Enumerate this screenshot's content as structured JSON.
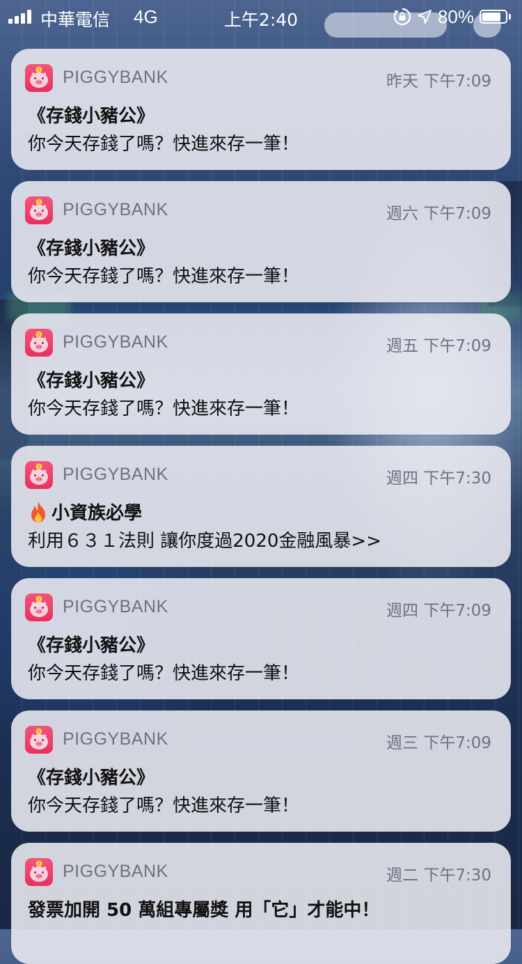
{
  "status_bar": {
    "carrier": "中華電信",
    "network": "4G",
    "time": "上午2:40",
    "battery_percent": "80%",
    "battery_level": 0.8,
    "icons": [
      "signal-icon",
      "rotation-lock-icon",
      "location-arrow-icon",
      "battery-icon"
    ]
  },
  "notifications": [
    {
      "app_name": "PIGGYBANK",
      "time": "昨天 下午7:09",
      "title": "《存錢小豬公》",
      "body": "你今天存錢了嗎？快進來存一筆！"
    },
    {
      "app_name": "PIGGYBANK",
      "time": "週六 下午7:09",
      "title": "《存錢小豬公》",
      "body": "你今天存錢了嗎？快進來存一筆！"
    },
    {
      "app_name": "PIGGYBANK",
      "time": "週五 下午7:09",
      "title": "《存錢小豬公》",
      "body": "你今天存錢了嗎？快進來存一筆！"
    },
    {
      "app_name": "PIGGYBANK",
      "time": "週四 下午7:30",
      "title": "小資族必學",
      "title_icon": "fire-icon",
      "body": "利用６３１法則 讓你度過2020金融風暴>>"
    },
    {
      "app_name": "PIGGYBANK",
      "time": "週四 下午7:09",
      "title": "《存錢小豬公》",
      "body": "你今天存錢了嗎？快進來存一筆！"
    },
    {
      "app_name": "PIGGYBANK",
      "time": "週三 下午7:09",
      "title": "《存錢小豬公》",
      "body": "你今天存錢了嗎？快進來存一筆！"
    },
    {
      "app_name": "PIGGYBANK",
      "time": "週二 下午7:30",
      "title": "發票加開 50 萬組專屬獎 用「它」才能中！",
      "body": ""
    }
  ],
  "colors": {
    "app_icon": "#e8305f",
    "card_background": "#ececf2",
    "secondary_text": "#707080",
    "primary_text": "#111111"
  }
}
